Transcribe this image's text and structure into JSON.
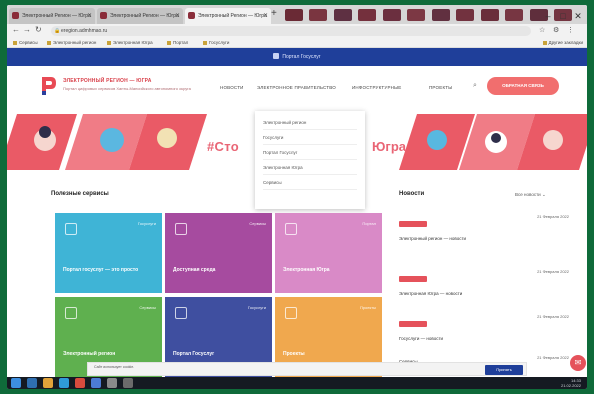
{
  "browser": {
    "tabs": [
      {
        "label": "Электронный Регион — Югра"
      },
      {
        "label": "Электронный Регион — Югра"
      },
      {
        "label": "Электронный Регион — Югра"
      }
    ],
    "new_tab": "+",
    "url": "eregion.admhmao.ru",
    "bookmarks": [
      "Сервисы",
      "Электронный регион",
      "Электронная Югра",
      "Портал",
      "Госуслуги"
    ],
    "other_bookmarks": "Другие закладки"
  },
  "site": {
    "gos_bar": "Портал Госуслуг",
    "brand": "ЭЛЕКТРОННЫЙ РЕГИОН — ЮГРА",
    "tagline": "Портал цифровых сервисов Ханты-Мансийского автономного округа",
    "menu": [
      "НОВОСТИ",
      "ЭЛЕКТРОННОЕ ПРАВИТЕЛЬСТВО",
      "ИНФОСТРУКТУРНЫЕ",
      "ПРОЕКТЫ"
    ],
    "cta": "ОБРАТНАЯ СВЯЗЬ",
    "banner_left": "#Сто",
    "banner_right": "Югра",
    "dropdown": [
      "Электронный регион",
      "Госуслуги",
      "Портал Госуслуг",
      "Электронная Югра",
      "Сервисы"
    ]
  },
  "content": {
    "section_title": "Полезные сервисы",
    "tiles": [
      {
        "name": "Портал госуслуг — это просто",
        "tag": "Госуслуги",
        "color": "#3fb4d6"
      },
      {
        "name": "Доступная среда",
        "tag": "Сервисы",
        "color": "#a64b9f"
      },
      {
        "name": "Электронная Югра",
        "tag": "Портал",
        "color": "#d98ac7"
      },
      {
        "name": "Электронный регион",
        "tag": "Сервисы",
        "color": "#5fb04f"
      },
      {
        "name": "Портал Госуслуг",
        "tag": "Госуслуги",
        "color": "#3f4fa0"
      },
      {
        "name": "Проекты",
        "tag": "Проекты",
        "color": "#f0a84e"
      }
    ],
    "news_title": "Новости",
    "news_all": "Все новости",
    "news": [
      {
        "date": "21 Февраля 2022",
        "text": "Электронный регион — новости"
      },
      {
        "date": "21 Февраля 2022",
        "text": "Электронная Югра — новости"
      },
      {
        "date": "21 Февраля 2022",
        "text": "Госуслуги — новости"
      },
      {
        "date": "21 Февраля 2022",
        "text": "Сервисы"
      }
    ]
  },
  "cookie": {
    "text": "Сайт использует cookie.",
    "button": "Принять"
  },
  "taskbar": {
    "time": "14:33",
    "date": "21.02.2022"
  }
}
